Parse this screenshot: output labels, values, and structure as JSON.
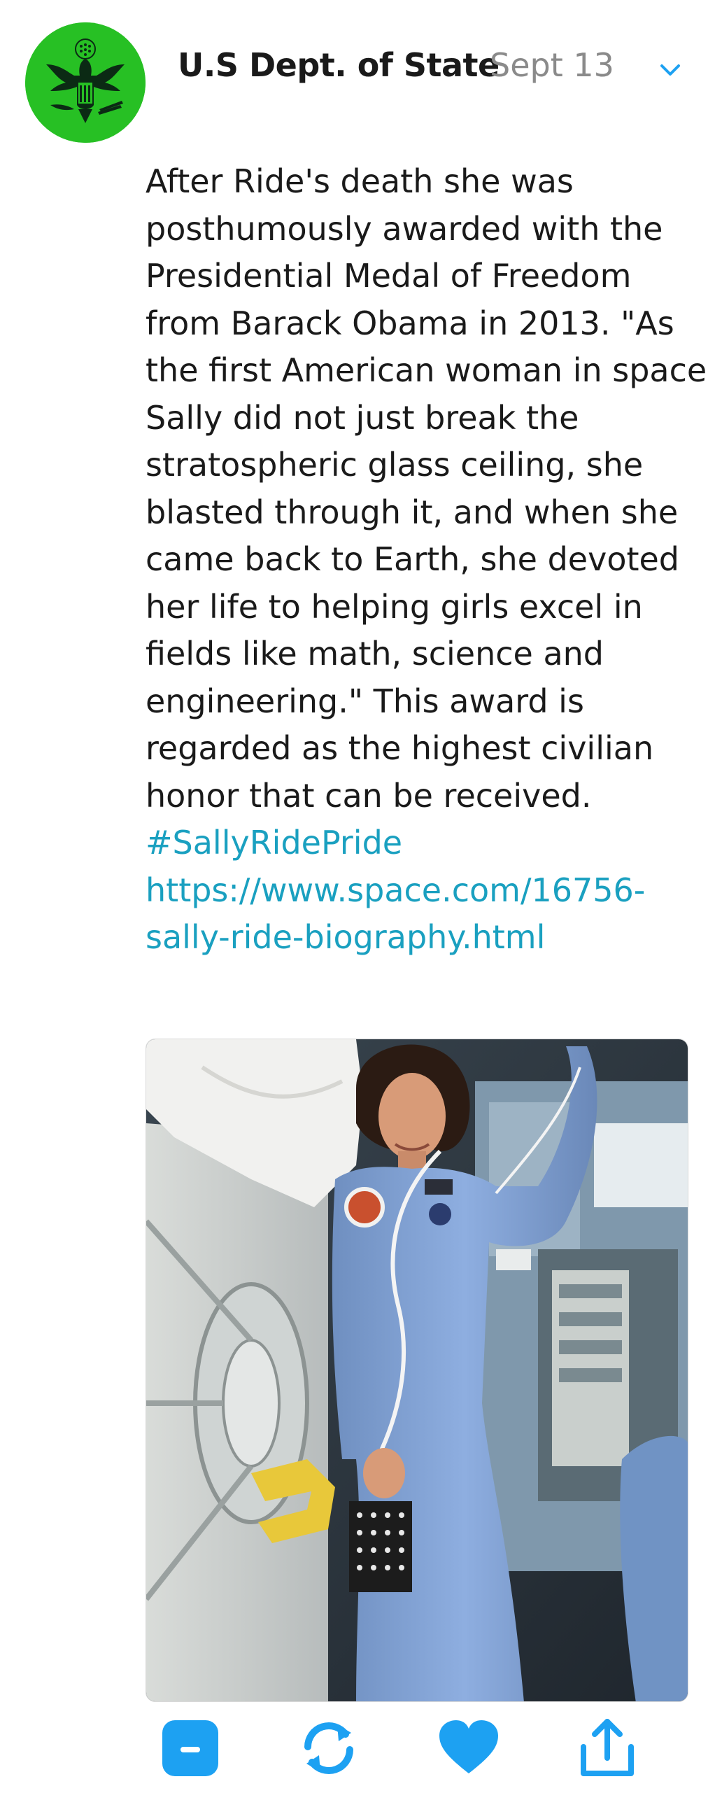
{
  "tweet": {
    "author": "U.S Dept. of State",
    "date": "Sept 13",
    "body_lines": [
      "After Ride's death she was",
      "posthumously awarded with the",
      "Presidential Medal of Freedom",
      "from Barack Obama in 2013. \"As",
      "the first American woman in space,",
      "Sally did not just break the",
      "stratospheric glass ceiling, she",
      "blasted through it, and when she",
      "came back to Earth, she devoted",
      "her life to helping girls excel in",
      "fields like math, science and",
      "engineering.\" This award is",
      "regarded as the highest civilian",
      "honor that can be received."
    ],
    "hashtag": "#SallyRidePride",
    "link_line_1": "https://www.space.com/16756-",
    "link_line_2": "sally-ride-biography.html",
    "media_icon": "astronaut-photo"
  },
  "icons": {
    "avatar": "us-state-department-seal-icon",
    "menu": "chevron-down-icon",
    "reply": "reply-icon",
    "retweet": "retweet-icon",
    "like": "heart-icon",
    "share": "share-icon"
  },
  "colors": {
    "accent": "#1da1f2",
    "link": "#1aa0c0",
    "avatar_bg": "#27c024",
    "date": "#8a8a8a",
    "text": "#1a1a1a"
  }
}
